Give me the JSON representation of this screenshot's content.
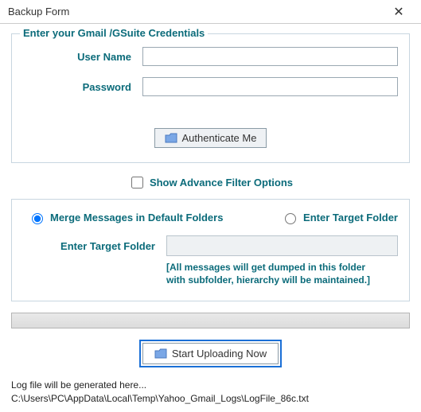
{
  "window": {
    "title": "Backup Form",
    "close_glyph": "✕"
  },
  "credentials": {
    "section_title": "Enter your Gmail /GSuite Credentials",
    "username_label": "User Name",
    "username_value": "",
    "password_label": "Password",
    "password_value": "",
    "authenticate_label": "Authenticate Me"
  },
  "advanced": {
    "checkbox_checked": false,
    "label": "Show Advance Filter Options"
  },
  "folders": {
    "merge_label": "Merge Messages in Default Folders",
    "target_radio_label": "Enter Target Folder",
    "selected": "merge",
    "target_field_label": "Enter Target Folder",
    "target_value": "",
    "note_line1": "[All messages will get dumped in this folder",
    "note_line2": "with subfolder, hierarchy will be maintained.]"
  },
  "upload": {
    "button_label": "Start Uploading Now"
  },
  "log": {
    "line1": "Log file will be generated here...",
    "line2": "C:\\Users\\PC\\AppData\\Local\\Temp\\Yahoo_Gmail_Logs\\LogFile_86c.txt"
  },
  "icons": {
    "folder_fill": "#7aa7e6",
    "folder_stroke": "#4a79bf"
  }
}
